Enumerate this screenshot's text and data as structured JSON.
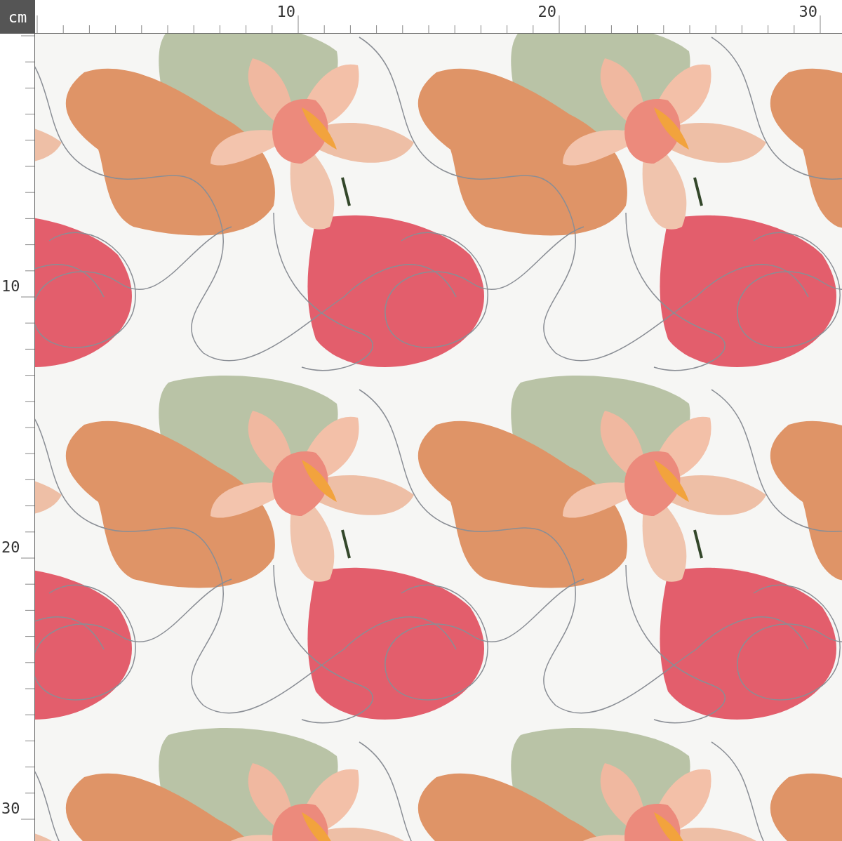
{
  "ruler_unit": "cm",
  "top_ruler": {
    "labels": [
      "10",
      "20",
      "30"
    ]
  },
  "left_ruler": {
    "labels": [
      "10",
      "20",
      "30"
    ]
  }
}
